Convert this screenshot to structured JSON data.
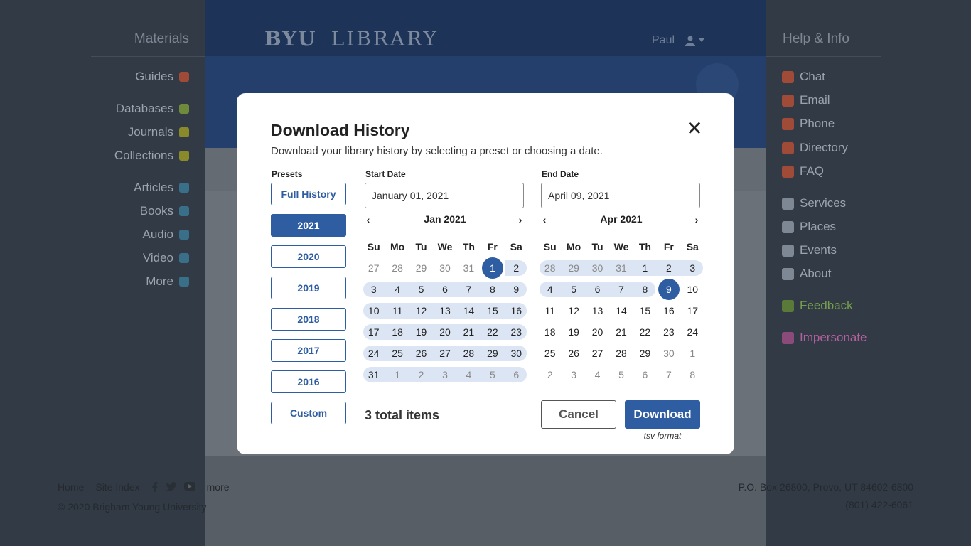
{
  "colors": {
    "primary": "#2f5da1",
    "range": "#dce5f3",
    "overlay": "#313a45"
  },
  "background": {
    "materials": {
      "title": "Materials",
      "items": [
        {
          "label": "Guides",
          "icon": "compass-icon",
          "color": "#a04a38"
        },
        {
          "label": "Databases",
          "icon": "layers-icon",
          "color": "#6f8a3a"
        },
        {
          "label": "Journals",
          "icon": "books-icon",
          "color": "#8a8a2a"
        },
        {
          "label": "Collections",
          "icon": "inbox-icon",
          "color": "#8a8a2a"
        },
        {
          "label": "Articles",
          "icon": "document-icon",
          "color": "#3a6f8a"
        },
        {
          "label": "Books",
          "icon": "book-icon",
          "color": "#3a6f8a"
        },
        {
          "label": "Audio",
          "icon": "headphones-icon",
          "color": "#3a6f8a"
        },
        {
          "label": "Video",
          "icon": "video-icon",
          "color": "#3a6f8a"
        },
        {
          "label": "More",
          "icon": "arrow-right-icon",
          "color": "#3a6f8a"
        }
      ]
    },
    "help": {
      "title": "Help & Info",
      "items": [
        {
          "label": "Chat",
          "icon": "chat-icon",
          "color": "#a04a38"
        },
        {
          "label": "Email",
          "icon": "envelope-icon",
          "color": "#a04a38"
        },
        {
          "label": "Phone",
          "icon": "phone-icon",
          "color": "#a04a38"
        },
        {
          "label": "Directory",
          "icon": "person-icon",
          "color": "#a04a38"
        },
        {
          "label": "FAQ",
          "icon": "question-icon",
          "color": "#a04a38"
        },
        {
          "label": "Services",
          "icon": "paperclip-icon",
          "color": "#7e8794"
        },
        {
          "label": "Places",
          "icon": "pin-icon",
          "color": "#7e8794"
        },
        {
          "label": "Events",
          "icon": "calendar-icon",
          "color": "#7e8794"
        },
        {
          "label": "About",
          "icon": "info-icon",
          "color": "#7e8794"
        },
        {
          "label": "Feedback",
          "icon": "thumbs-up-icon",
          "color": "#5a7a3a"
        },
        {
          "label": "Impersonate",
          "icon": "impersonate-icon",
          "color": "#8a4a7a"
        }
      ]
    },
    "header": {
      "logo_byu": "BYU",
      "logo_library": "LIBRARY",
      "user": "Paul"
    },
    "footer": {
      "home": "Home",
      "site_index": "Site Index",
      "more": "more",
      "copyright": "© 2020 Brigham Young University",
      "address": "P.O. Box 26800, Provo, UT 84602-6800",
      "phone": "(801) 422-6061"
    }
  },
  "modal": {
    "title": "Download History",
    "subtitle": "Download your library history by selecting a preset or choosing a date.",
    "presets_label": "Presets",
    "presets": [
      "Full History",
      "2021",
      "2020",
      "2019",
      "2018",
      "2017",
      "2016",
      "Custom"
    ],
    "active_preset": "2021",
    "start": {
      "label": "Start Date",
      "value": "January 01, 2021",
      "month": "Jan 2021",
      "days": [
        [
          "27",
          "28",
          "29",
          "30",
          "31",
          "1",
          "2"
        ],
        [
          "3",
          "4",
          "5",
          "6",
          "7",
          "8",
          "9"
        ],
        [
          "10",
          "11",
          "12",
          "13",
          "14",
          "15",
          "16"
        ],
        [
          "17",
          "18",
          "19",
          "20",
          "21",
          "22",
          "23"
        ],
        [
          "24",
          "25",
          "26",
          "27",
          "28",
          "29",
          "30"
        ],
        [
          "31",
          "1",
          "2",
          "3",
          "4",
          "5",
          "6"
        ]
      ],
      "selected": "1"
    },
    "end": {
      "label": "End Date",
      "value": "April  09, 2021",
      "month": "Apr 2021",
      "days": [
        [
          "28",
          "29",
          "30",
          "31",
          "1",
          "2",
          "3"
        ],
        [
          "4",
          "5",
          "6",
          "7",
          "8",
          "9",
          "10"
        ],
        [
          "11",
          "12",
          "13",
          "14",
          "15",
          "16",
          "17"
        ],
        [
          "18",
          "19",
          "20",
          "21",
          "22",
          "23",
          "24"
        ],
        [
          "25",
          "26",
          "27",
          "28",
          "29",
          "30",
          "1"
        ],
        [
          "2",
          "3",
          "4",
          "5",
          "6",
          "7",
          "8"
        ]
      ],
      "selected": "9"
    },
    "weekdays": [
      "Su",
      "Mo",
      "Tu",
      "We",
      "Th",
      "Fr",
      "Sa"
    ],
    "total": "3 total items",
    "cancel": "Cancel",
    "download": "Download",
    "format": "tsv format"
  }
}
